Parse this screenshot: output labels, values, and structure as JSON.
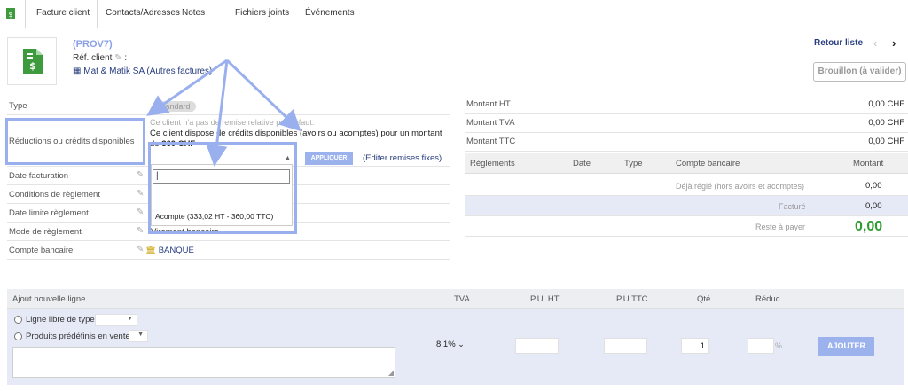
{
  "tabs": [
    {
      "label": "Facture client",
      "active": true
    },
    {
      "label": "Contacts/Adresses"
    },
    {
      "label": "Notes"
    },
    {
      "label": "Fichiers joints"
    },
    {
      "label": "Événements"
    }
  ],
  "header": {
    "ref": "(PROV7)",
    "ref_client": "Réf. client",
    "ref_client_suffix": ":",
    "company": "Mat & Matik SA (Autres factures)",
    "back_link": "Retour liste",
    "prev_icon": "‹",
    "next_icon": "›",
    "status": "Brouillon (à valider)"
  },
  "fields": {
    "type_label": "Type",
    "type_value": "Standard",
    "reductions_label": "Réductions ou crédits disponibles",
    "no_relative_discount": "Ce client n'a pas de remise relative par défaut.",
    "credits_text": "Ce client dispose de crédits disponibles (avoirs ou acomptes) pour un montant de",
    "credits_amount": "360 CHF",
    "apply_button": "APPLIQUER",
    "edit_fixed_discounts": "(Editer remises fixes)",
    "date_label": "Date facturation",
    "conditions_label": "Conditions de règlement",
    "due_date_label": "Date limite règlement",
    "payment_mode_label": "Mode de règlement",
    "payment_mode_value": "Virement bancaire",
    "bank_account_label": "Compte bancaire",
    "bank_account_value": "BANQUE"
  },
  "dropdown": {
    "input_value": "|",
    "option": "Acompte (333,02 HT - 360,00 TTC)"
  },
  "totals": {
    "ht_label": "Montant HT",
    "ht_value": "0,00 CHF",
    "tva_label": "Montant TVA",
    "tva_value": "0,00 CHF",
    "ttc_label": "Montant TTC",
    "ttc_value": "0,00 CHF"
  },
  "payments": {
    "columns": [
      "Règlements",
      "Date",
      "Type",
      "Compte bancaire",
      "Montant"
    ],
    "already_paid_label": "Déjà réglé (hors avoirs et acomptes)",
    "already_paid_value": "0,00",
    "invoiced_label": "Facturé",
    "invoiced_value": "0,00",
    "remaining_label": "Reste à payer",
    "remaining_value": "0,00"
  },
  "add_line": {
    "columns": [
      "Ajout nouvelle ligne",
      "TVA",
      "P.U. HT",
      "P.U TTC",
      "Qté",
      "Réduc."
    ],
    "free_line_label": "Ligne libre de type",
    "predefined_label": "Produits prédéfinis en vente",
    "vat_value": "8,1%",
    "qty_value": "1",
    "pct_symbol": "%",
    "add_button": "AJOUTER"
  },
  "colors": {
    "accent": "#9bb2ec",
    "link": "#263c7e",
    "positive": "#2e9c2e",
    "annotation": "#9ab0ee"
  }
}
